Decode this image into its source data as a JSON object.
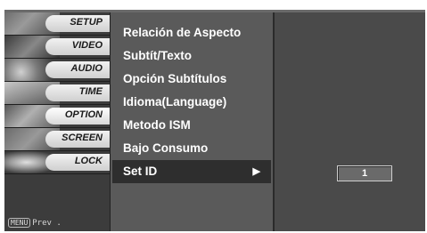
{
  "sidebar": {
    "items": [
      {
        "label": "SETUP"
      },
      {
        "label": "VIDEO"
      },
      {
        "label": "AUDIO"
      },
      {
        "label": "TIME"
      },
      {
        "label": "OPTION"
      },
      {
        "label": "SCREEN"
      },
      {
        "label": "LOCK"
      }
    ],
    "active_label": "OPTION",
    "footer": {
      "key": "MENU",
      "label": "Prev ."
    }
  },
  "menu": {
    "items": [
      {
        "label": "Relación de Aspecto"
      },
      {
        "label": "Subtít/Texto"
      },
      {
        "label": "Opción Subtítulos"
      },
      {
        "label": "Idioma(Language)"
      },
      {
        "label": "Metodo ISM"
      },
      {
        "label": "Bajo Consumo"
      },
      {
        "label": "Set ID"
      }
    ],
    "selected_label": "Set ID",
    "selected_arrow": "▶"
  },
  "right_panel": {
    "value": "1"
  },
  "colors": {
    "background": "#4a4a4a",
    "menu_background": "#5a5a5a",
    "selected_row": "#2e2e2e",
    "text": "#ffffff"
  }
}
